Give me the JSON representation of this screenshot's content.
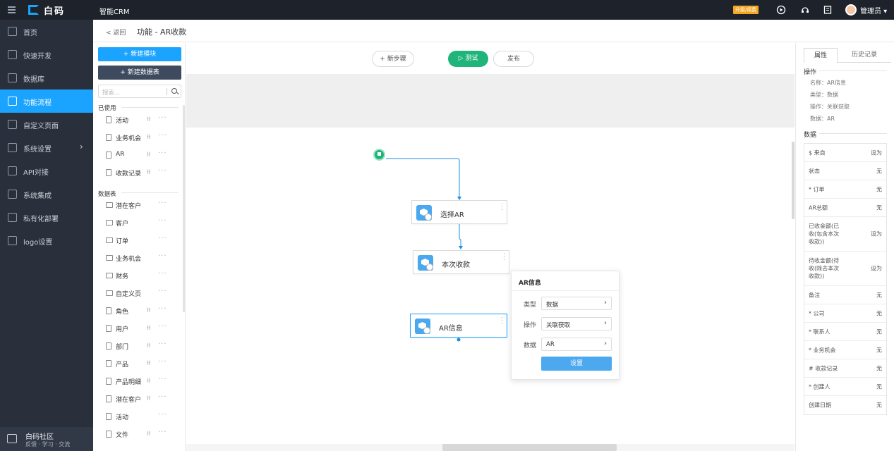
{
  "topbar": {
    "logo_text": "白码",
    "app_title": "智能CRM",
    "upgrade_label": "升级/续费",
    "user_name": "管理员 ▾"
  },
  "breadcrumb": {
    "back": "< 返回",
    "title": "功能 - AR收款"
  },
  "sidebar": {
    "items": [
      {
        "label": "首页",
        "icon": "home-icon"
      },
      {
        "label": "快速开发",
        "icon": "cube-icon"
      },
      {
        "label": "数据库",
        "icon": "database-icon"
      },
      {
        "label": "功能流程",
        "icon": "flow-icon"
      },
      {
        "label": "自定义页面",
        "icon": "page-icon"
      },
      {
        "label": "系统设置",
        "icon": "settings-icon"
      },
      {
        "label": "API对接",
        "icon": "api-icon"
      },
      {
        "label": "系统集成",
        "icon": "integration-icon"
      },
      {
        "label": "私有化部署",
        "icon": "server-icon"
      },
      {
        "label": "logo设置",
        "icon": "logo-icon"
      }
    ],
    "community": {
      "title": "白码社区",
      "subtitle": "反馈 · 学习 · 交流"
    }
  },
  "modules": {
    "new_module": "+ 新建模块",
    "new_table": "+ 新建数据表",
    "search_placeholder": "搜索...",
    "used_label": "已使用",
    "used": [
      "活动",
      "业务机会",
      "AR",
      "收款记录"
    ],
    "tables_label": "数据表",
    "tables": [
      {
        "label": "潜在客户",
        "type": "folder"
      },
      {
        "label": "客户",
        "type": "folder"
      },
      {
        "label": "订单",
        "type": "folder"
      },
      {
        "label": "业务机会",
        "type": "folder"
      },
      {
        "label": "财务",
        "type": "folder"
      },
      {
        "label": "自定义页",
        "type": "folder"
      },
      {
        "label": "角色",
        "type": "file"
      },
      {
        "label": "用户",
        "type": "file"
      },
      {
        "label": "部门",
        "type": "file"
      },
      {
        "label": "产品",
        "type": "file"
      },
      {
        "label": "产品明细",
        "type": "file"
      },
      {
        "label": "潜在客户",
        "type": "file"
      },
      {
        "label": "活动",
        "type": "file"
      },
      {
        "label": "文件",
        "type": "file"
      }
    ]
  },
  "canvas": {
    "new_step": "+ 新步骤",
    "test": "▷ 测试",
    "publish": "发布",
    "nodes": [
      "选择AR",
      "本次收款",
      "AR信息"
    ]
  },
  "popup": {
    "title": "AR信息",
    "rows": [
      {
        "label": "类型",
        "value": "数据"
      },
      {
        "label": "操作",
        "value": "关联获取"
      },
      {
        "label": "数据",
        "value": "AR"
      }
    ],
    "button": "设置"
  },
  "rpanel": {
    "tab_props": "属性",
    "tab_history": "历史记录",
    "op_label": "操作",
    "op_items": [
      "名称：AR信息",
      "类型：数据",
      "操作：关联获取",
      "数据：AR"
    ],
    "data_label": "数据",
    "rows": [
      {
        "k": "$ 来自",
        "v": "设为"
      },
      {
        "k": "状态",
        "v": "无"
      },
      {
        "k": "* 订单",
        "v": "无"
      },
      {
        "k": "AR总额",
        "v": "无"
      },
      {
        "k": "已收金额(已收(包含本次收款))",
        "v": "设为"
      },
      {
        "k": "待收金额(待收(除去本次收款))",
        "v": "设为"
      },
      {
        "k": "备注",
        "v": "无"
      },
      {
        "k": "* 公司",
        "v": "无"
      },
      {
        "k": "* 联系人",
        "v": "无"
      },
      {
        "k": "* 业务机会",
        "v": "无"
      },
      {
        "k": "# 收款记录",
        "v": "无"
      },
      {
        "k": "* 创建人",
        "v": "无"
      },
      {
        "k": "创建日期",
        "v": "无"
      }
    ]
  }
}
